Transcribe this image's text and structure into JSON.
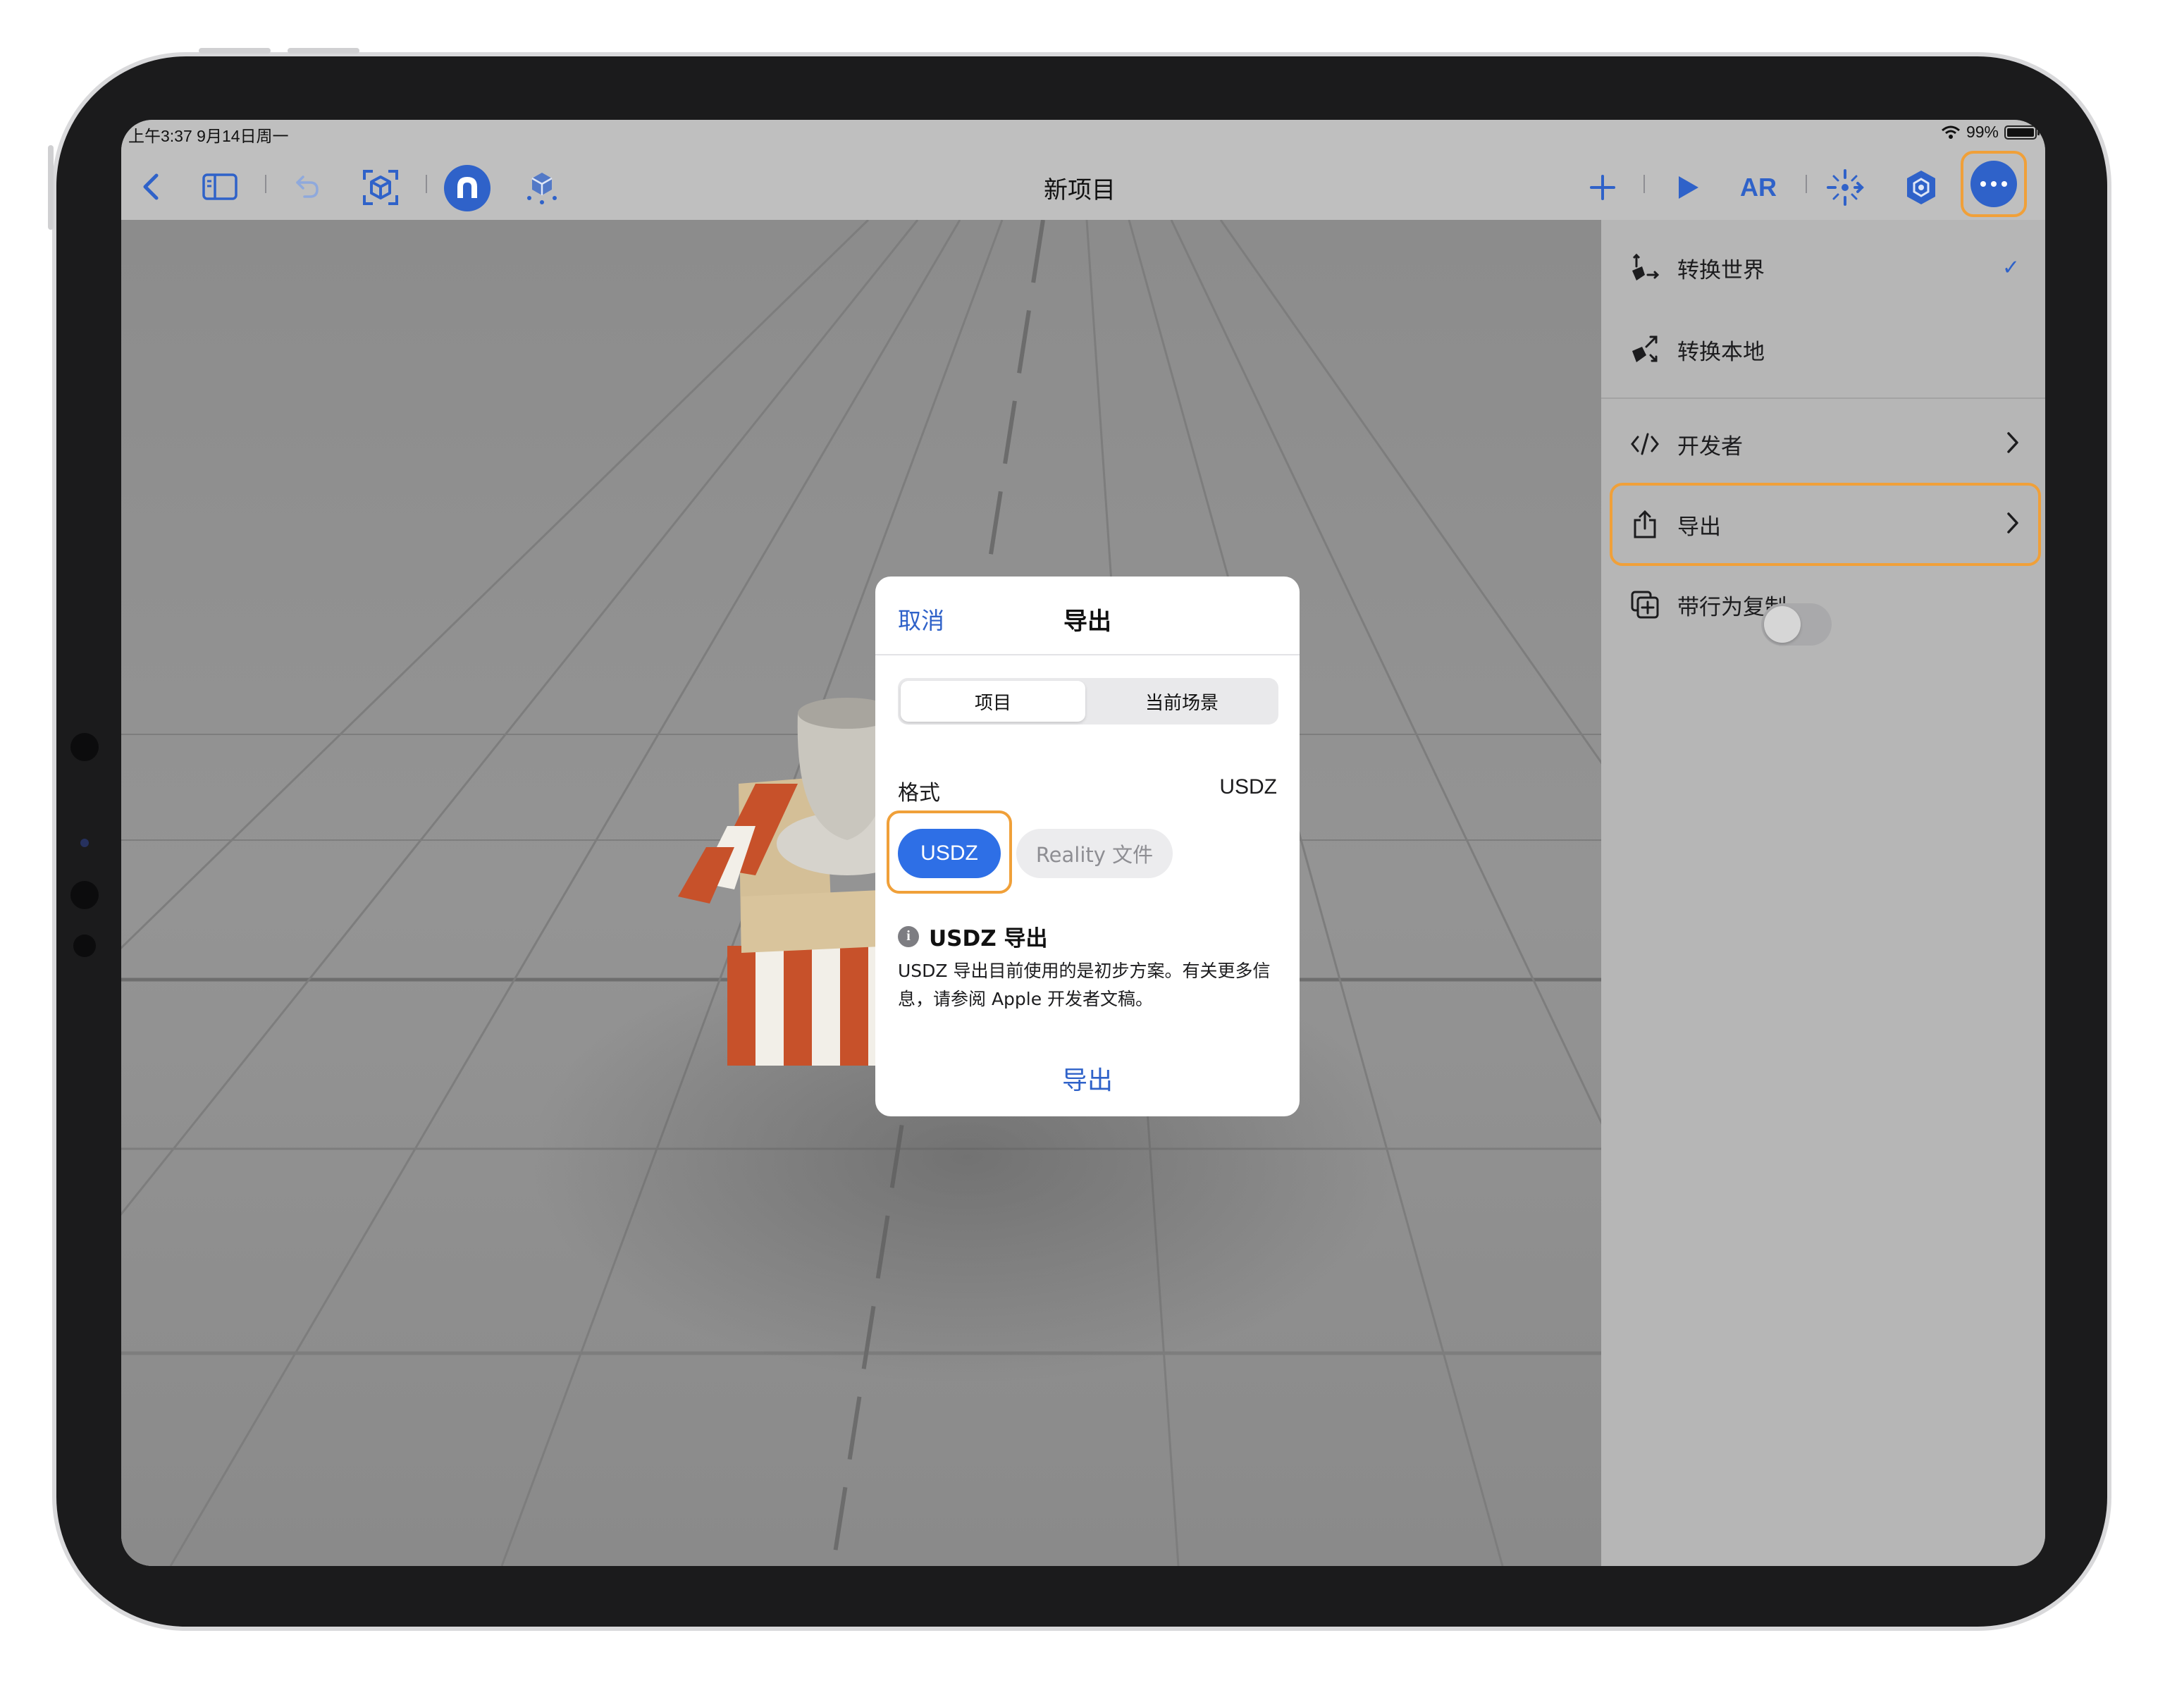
{
  "status_bar": {
    "time_date": "上午3:37   9月14日周一",
    "battery_pct": "99%"
  },
  "toolbar": {
    "title": "新项目",
    "ar_label": "AR",
    "add_symbol": "+"
  },
  "side_menu": {
    "transform_world": "转换世界",
    "transform_world_check": "✓",
    "transform_local": "转换本地",
    "developer": "开发者",
    "export": "导出",
    "duplicate_with_behaviors": "带行为复制"
  },
  "dialog": {
    "cancel": "取消",
    "title": "导出",
    "segments": [
      "项目",
      "当前场景"
    ],
    "format_label": "格式",
    "format_value": "USDZ",
    "chips": [
      "USDZ",
      "Reality 文件"
    ],
    "info_title": "USDZ 导出",
    "info_body": "USDZ 导出目前使用的是初步方案。有关更多信息，请参阅 Apple 开发者文稿。",
    "export_button": "导出"
  },
  "colors": {
    "accent": "#2f62c9",
    "highlight": "#f0a039",
    "chip_selected": "#2e6fe6"
  }
}
